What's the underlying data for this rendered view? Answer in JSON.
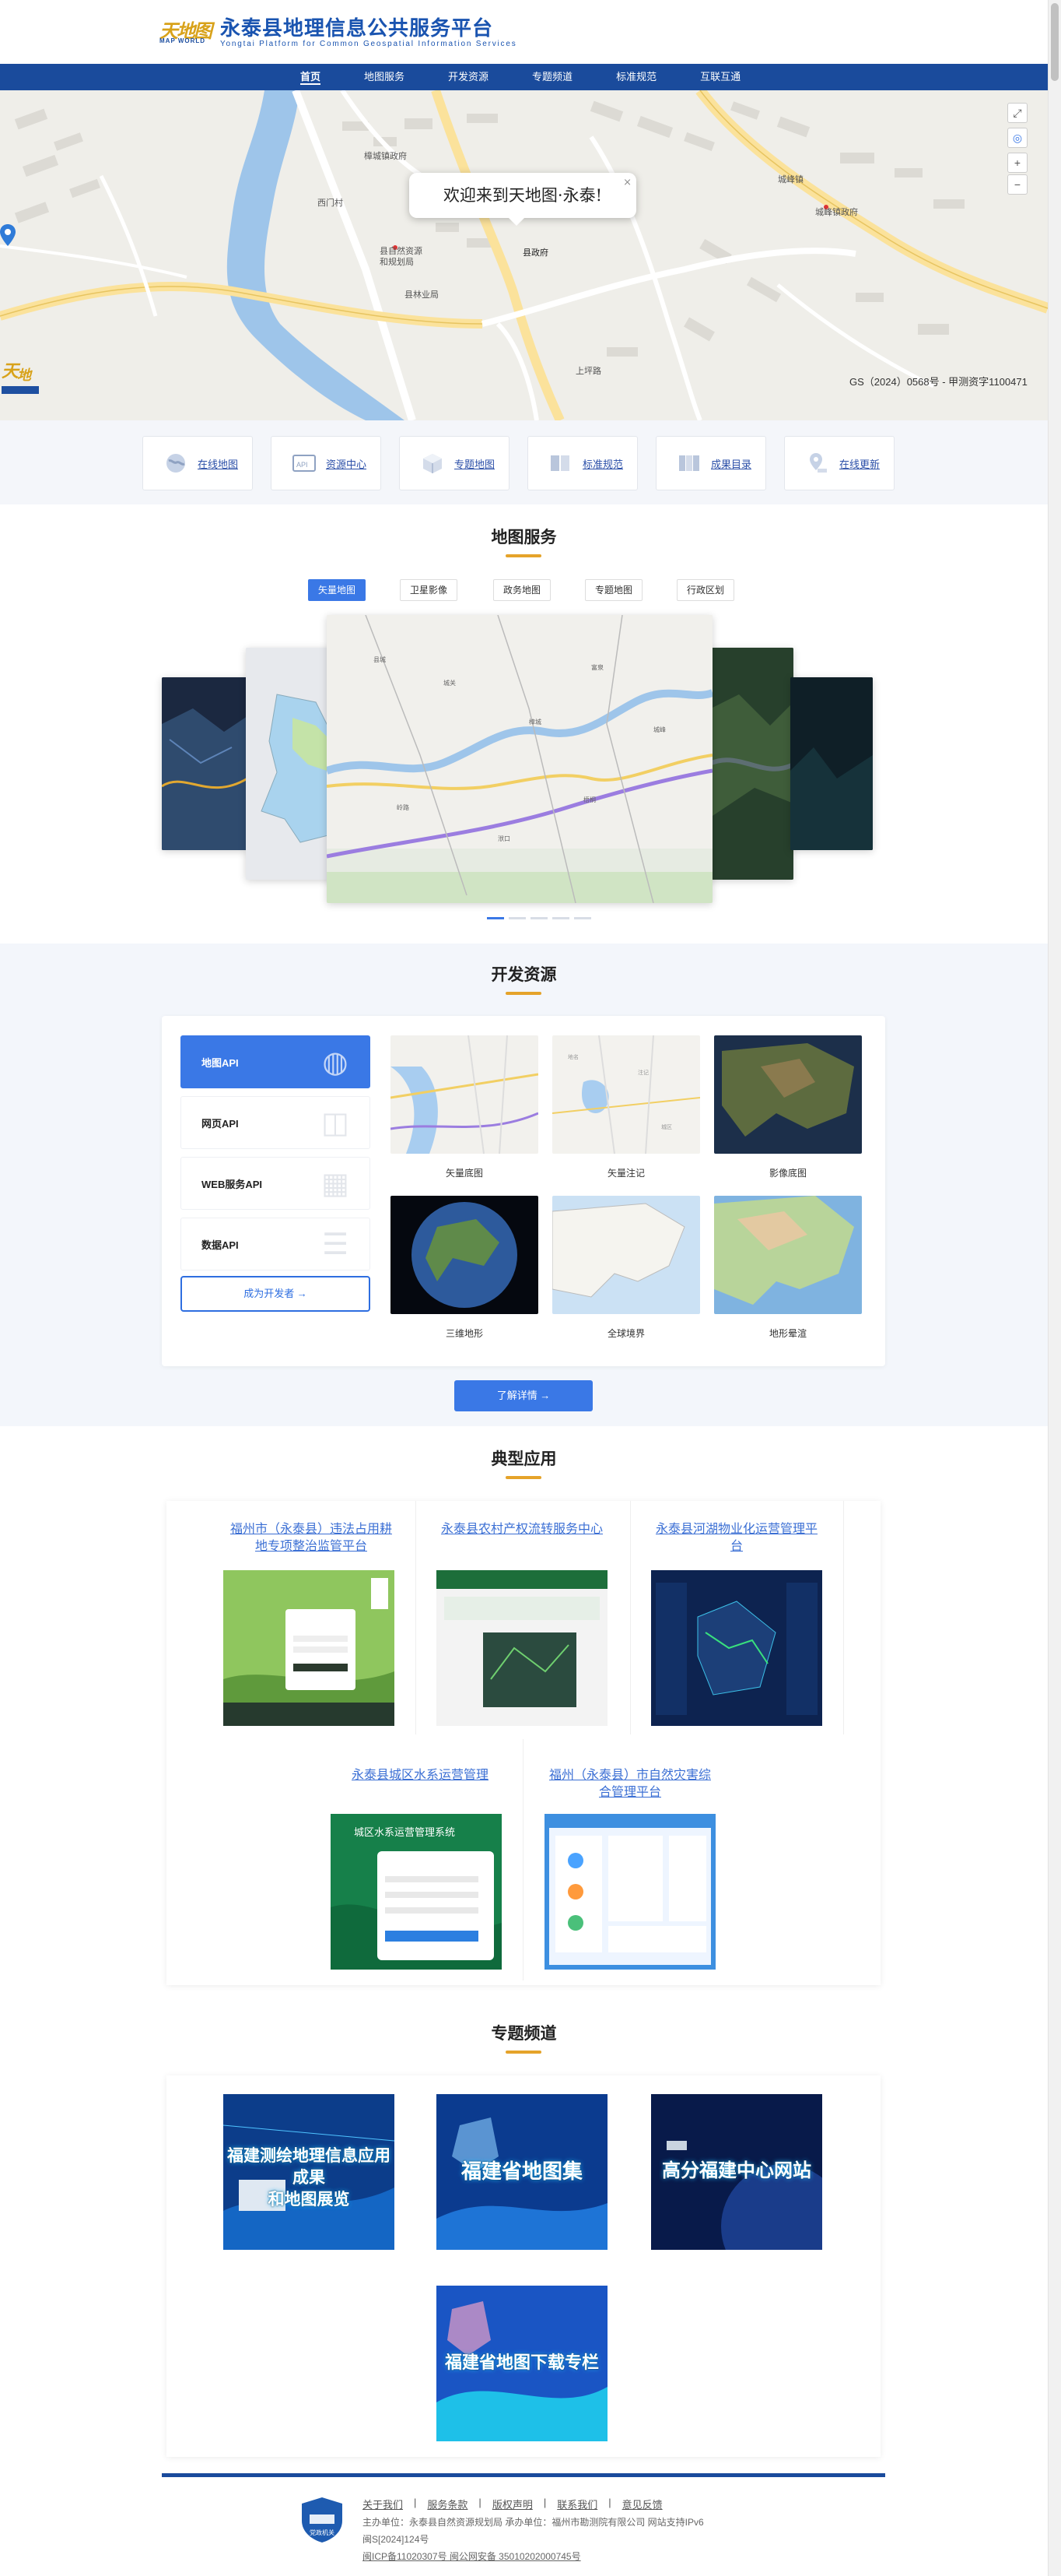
{
  "header": {
    "logo_mark": "天地图",
    "logo_mark_sub": "MAP WORLD",
    "title": "永泰县地理信息公共服务平台",
    "subtitle": "Yongtai Platform for Common Geospatial Information Services"
  },
  "nav": {
    "items": [
      {
        "label": "首页",
        "active": true
      },
      {
        "label": "地图服务"
      },
      {
        "label": "开发资源"
      },
      {
        "label": "专题频道"
      },
      {
        "label": "标准规范"
      },
      {
        "label": "互联互通"
      }
    ]
  },
  "map": {
    "popup_text": "欢迎来到天地图·永泰!",
    "close_glyph": "×",
    "gs_text": "GS（2024）0568号 - 甲测资字1100471",
    "place_labels": [
      "樟城镇政府",
      "县自然资源和规划局",
      "县政府",
      "城峰镇",
      "西门村",
      "县林业局",
      "上坪路",
      "城峰镇政府"
    ],
    "controls": [
      "⤢",
      "◎",
      "+",
      "−"
    ]
  },
  "quick_links": [
    {
      "label": "在线地图",
      "icon": "globe-icon"
    },
    {
      "label": "资源中心",
      "icon": "api-icon"
    },
    {
      "label": "专题地图",
      "icon": "cube-icon"
    },
    {
      "label": "标准规范",
      "icon": "book-icon"
    },
    {
      "label": "成果目录",
      "icon": "catalog-icon"
    },
    {
      "label": "在线更新",
      "icon": "location-icon"
    }
  ],
  "map_service": {
    "title": "地图服务",
    "tabs": [
      {
        "label": "矢量地图",
        "active": true
      },
      {
        "label": "卫星影像"
      },
      {
        "label": "政务地图"
      },
      {
        "label": "专题地图"
      },
      {
        "label": "行政区划"
      }
    ],
    "dots": 5
  },
  "dev": {
    "title": "开发资源",
    "apis": [
      {
        "label": "地图API",
        "active": true
      },
      {
        "label": "网页API"
      },
      {
        "label": "WEB服务API"
      },
      {
        "label": "数据API"
      }
    ],
    "become_dev": "成为开发者 →",
    "thumbs": [
      {
        "label": "矢量底图"
      },
      {
        "label": "矢量注记"
      },
      {
        "label": "影像底图"
      },
      {
        "label": "三维地形"
      },
      {
        "label": "全球境界"
      },
      {
        "label": "地形晕渲"
      }
    ],
    "detail_btn": "了解详情 →"
  },
  "apps": {
    "title": "典型应用",
    "items": [
      {
        "title": "福州市（永泰县）违法占用耕地专项整治监管平台"
      },
      {
        "title": "永泰县农村产权流转服务中心"
      },
      {
        "title": "永泰县河湖物业化运营管理平台"
      },
      {
        "title": "永泰县城区水系运营管理"
      },
      {
        "title": "福州（永泰县）市自然灾害综合管理平台"
      }
    ],
    "screens": {
      "app4_heading": "城区水系运营管理系统"
    }
  },
  "channels": {
    "title": "专题频道",
    "items": [
      {
        "text": "福建测绘地理信息应用成果\n和地图展览"
      },
      {
        "text": "福建省地图集"
      },
      {
        "text": "高分福建中心网站"
      },
      {
        "text": "福建省地图下载专栏"
      }
    ]
  },
  "footer": {
    "links": [
      "关于我们",
      "服务条款",
      "版权声明",
      "联系我们",
      "意见反馈"
    ],
    "org": "主办单位：永泰县自然资源规划局 承办单位：福州市勘测院有限公司 网站支持IPv6",
    "review": "闽S[2024]124号",
    "icp": "闽ICP备11020307号 闽公网安备 35010202000745号",
    "badge": "党政机关"
  },
  "colors": {
    "brand_blue": "#1a4b9c",
    "accent_blue": "#3a78e6",
    "title_underline": "#e5a32a",
    "link_blue": "#3b6fd4"
  }
}
